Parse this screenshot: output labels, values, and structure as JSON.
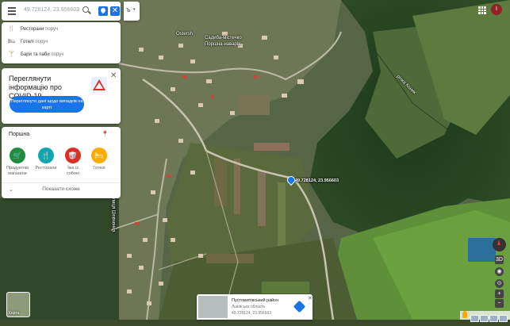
{
  "search": {
    "placeholder": "49.728124, 23.956603 – по"
  },
  "quick_searches": [
    {
      "icon": "restaurant-icon",
      "glyph": "🍴",
      "label": "Ресторани",
      "sub": "поруч"
    },
    {
      "icon": "hotel-icon",
      "glyph": "🛏",
      "label": "Готелі",
      "sub": "поруч"
    },
    {
      "icon": "bar-icon",
      "glyph": "🍸",
      "label": "Бари та паби",
      "sub": "поруч"
    }
  ],
  "covid": {
    "title": "Переглянути інформацію про COVID-19",
    "button": "Переглянути дані щодо випадків на карті"
  },
  "explore": {
    "title": "Поршна",
    "categories": [
      {
        "label": "Продуктові магазини",
        "color": "#1e8e3e",
        "glyph": "🛒"
      },
      {
        "label": "Ресторани",
        "color": "#12a4af",
        "glyph": "🍴"
      },
      {
        "label": "Їжа із собою",
        "color": "#d93025",
        "glyph": "🥡"
      },
      {
        "label": "Готелі",
        "color": "#f9ab00",
        "glyph": "🛏"
      }
    ],
    "show_more": "Показати схоже"
  },
  "map_labels": {
    "village": "Ostersh",
    "estate": "Садиба-містечко Поршна-наварія",
    "river": "річка Коник",
    "street": "вулиця Шевченка"
  },
  "pin": {
    "coords": "49.728124, 23.956603"
  },
  "info_card": {
    "name": "Пустомитівський район",
    "region": "Львівська область",
    "coords": "49.728124, 23.956603"
  },
  "layers": {
    "label": "Карта"
  },
  "zoom_controls": [
    "3D",
    "+",
    "−"
  ],
  "avatar": {
    "initial": "I"
  },
  "colors": {
    "accent": "#1a73e8"
  }
}
